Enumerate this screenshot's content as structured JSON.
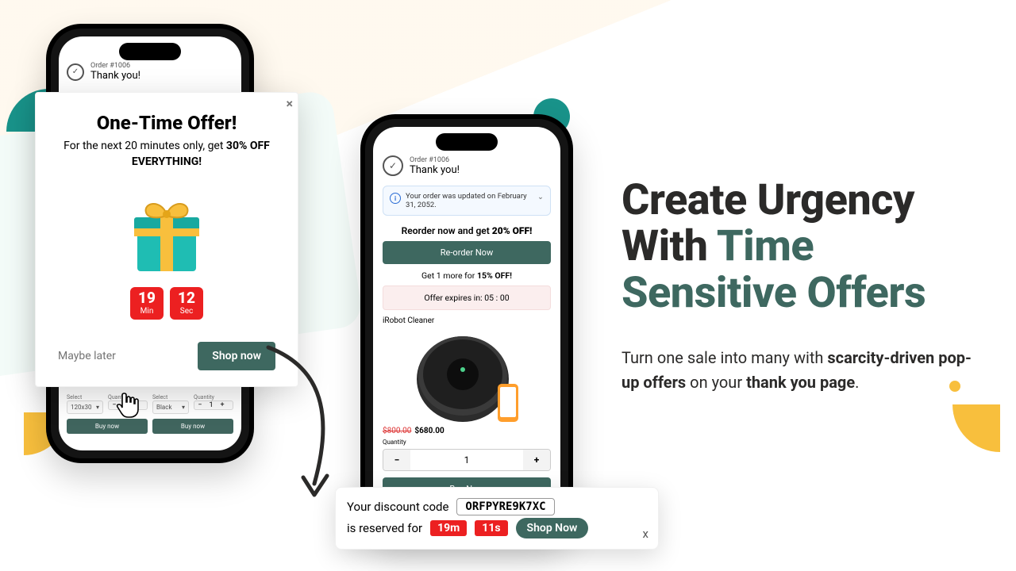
{
  "headline": {
    "part1": "Create Urgency With ",
    "accent": "Time Sensitive Offers"
  },
  "subhead": {
    "pre": "Turn one sale into many with ",
    "bold1": "scarcity-driven pop-up offers",
    "mid": " on your ",
    "bold2": "thank you page",
    "post": "."
  },
  "leftPhone": {
    "orderTag": "Order #1006",
    "thank": "Thank you!",
    "selectLabel": "Select",
    "variant": "120x30",
    "colorLabel": "Select",
    "color": "Black",
    "qtyLabel": "Quantity",
    "qty": "1",
    "buy": "Buy now"
  },
  "popup": {
    "title": "One-Time Offer!",
    "line_pre": "For the next 20 minutes only, get ",
    "line_bold": "30% OFF EVERYTHING!",
    "min_val": "19",
    "min_unit": "Min",
    "sec_val": "12",
    "sec_unit": "Sec",
    "maybe": "Maybe later",
    "shop": "Shop now"
  },
  "rightPhone": {
    "orderTag": "Order #1006",
    "thank": "Thank you!",
    "alert": "Your order was updated on February 31, 2052.",
    "reorder_pre": "Reorder now and get ",
    "reorder_bold": "20% OFF!",
    "reorderBtn": "Re-order Now",
    "get1_pre": "Get 1 more for ",
    "get1_bold": "15% OFF!",
    "expire": "Offer expires in: 05 : 00",
    "product": "iRobot Cleaner",
    "oldPrice": "$800.00",
    "newPrice": "$680.00",
    "qtyLabel": "Quantity",
    "qty": "1",
    "buy": "Buy Now"
  },
  "pill": {
    "l1": "Your discount code",
    "code": "ORFPYRE9K7XC",
    "l2": "is reserved for",
    "m": "19m",
    "s": "11s",
    "shop": "Shop Now",
    "close": "x"
  }
}
